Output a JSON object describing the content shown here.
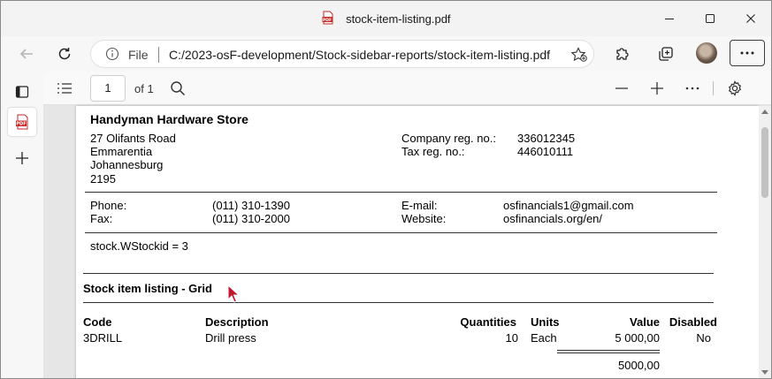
{
  "window": {
    "title": "stock-item-listing.pdf"
  },
  "addressbar": {
    "scheme_label": "File",
    "url": "C:/2023-osF-development/Stock-sidebar-reports/stock-item-listing.pdf"
  },
  "pdf_toolbar": {
    "page_number": "1",
    "page_count": "of 1"
  },
  "report": {
    "company_name": "Handyman Hardware Store",
    "address": [
      "27 Olifants Road",
      "Emmarentia",
      "Johannesburg",
      "2195"
    ],
    "company_reg_label": "Company reg. no.:",
    "company_reg_value": "336012345",
    "tax_reg_label": "Tax reg. no.:",
    "tax_reg_value": "446010111",
    "phone_label": "Phone:",
    "phone_value": "(011) 310-1390",
    "fax_label": "Fax:",
    "fax_value": "(011) 310-2000",
    "email_label": "E-mail:",
    "email_value": "osfinancials1@gmail.com",
    "website_label": "Website:",
    "website_value": "osfinancials.org/en/",
    "filter_text": "stock.WStockid = 3",
    "section_title": "Stock item listing - Grid",
    "columns": [
      "Code",
      "Description",
      "Quantities",
      "Units",
      "Value",
      "Disabled"
    ],
    "rows": [
      {
        "code": "3DRILL",
        "description": "Drill press",
        "quantity": "10",
        "unit": "Each",
        "value": "5 000,00",
        "disabled": "No"
      }
    ],
    "total_value": "5000,00"
  }
}
